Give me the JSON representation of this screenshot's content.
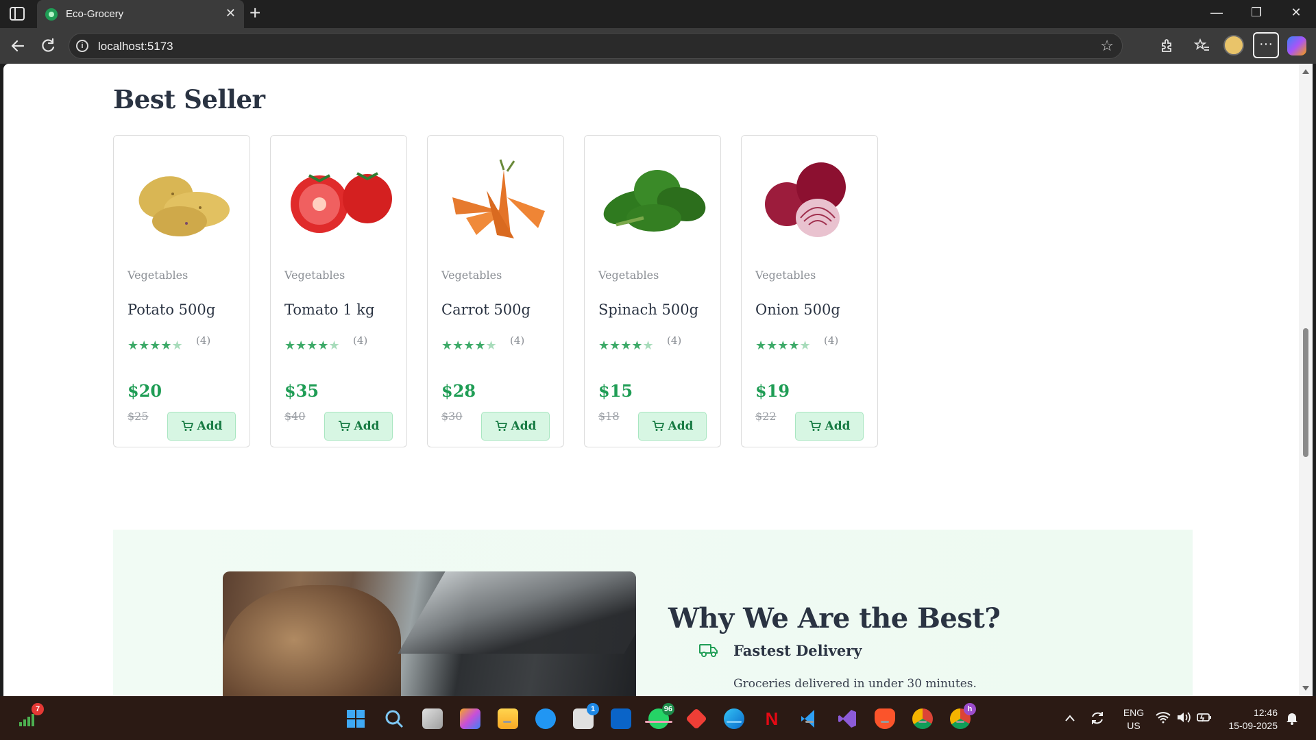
{
  "browser": {
    "tab_title": "Eco-Grocery",
    "tab_close": "✕",
    "new_tab": "+",
    "url": "localhost:5173",
    "more": "···"
  },
  "window": {
    "minimize": "—",
    "restore": "❐",
    "close": "✕"
  },
  "best_seller": {
    "title": "Best Seller",
    "add_label": "Add",
    "products": [
      {
        "category": "Vegetables",
        "name": "Potato 500g",
        "rating": 4,
        "reviews": "(4)",
        "price": "$20",
        "old_price": "$25"
      },
      {
        "category": "Vegetables",
        "name": "Tomato 1 kg",
        "rating": 4,
        "reviews": "(4)",
        "price": "$35",
        "old_price": "$40"
      },
      {
        "category": "Vegetables",
        "name": "Carrot 500g",
        "rating": 4,
        "reviews": "(4)",
        "price": "$28",
        "old_price": "$30"
      },
      {
        "category": "Vegetables",
        "name": "Spinach 500g",
        "rating": 4,
        "reviews": "(4)",
        "price": "$15",
        "old_price": "$18"
      },
      {
        "category": "Vegetables",
        "name": "Onion 500g",
        "rating": 4,
        "reviews": "(4)",
        "price": "$19",
        "old_price": "$22"
      }
    ]
  },
  "why": {
    "title": "Why We Are the Best?",
    "features": [
      {
        "icon": "truck-icon",
        "title": "Fastest Delivery",
        "desc": "Groceries delivered in under 30 minutes."
      }
    ]
  },
  "taskbar": {
    "badges": {
      "widgets": "7",
      "store": "1",
      "whatsapp": "96",
      "chrome_profile": "h"
    },
    "lang": "ENG",
    "region": "US",
    "time": "12:46",
    "date": "15-09-2025"
  },
  "colors": {
    "accent": "#1f9d55",
    "heading": "#2a3342",
    "add_bg": "#d7f6e3"
  }
}
